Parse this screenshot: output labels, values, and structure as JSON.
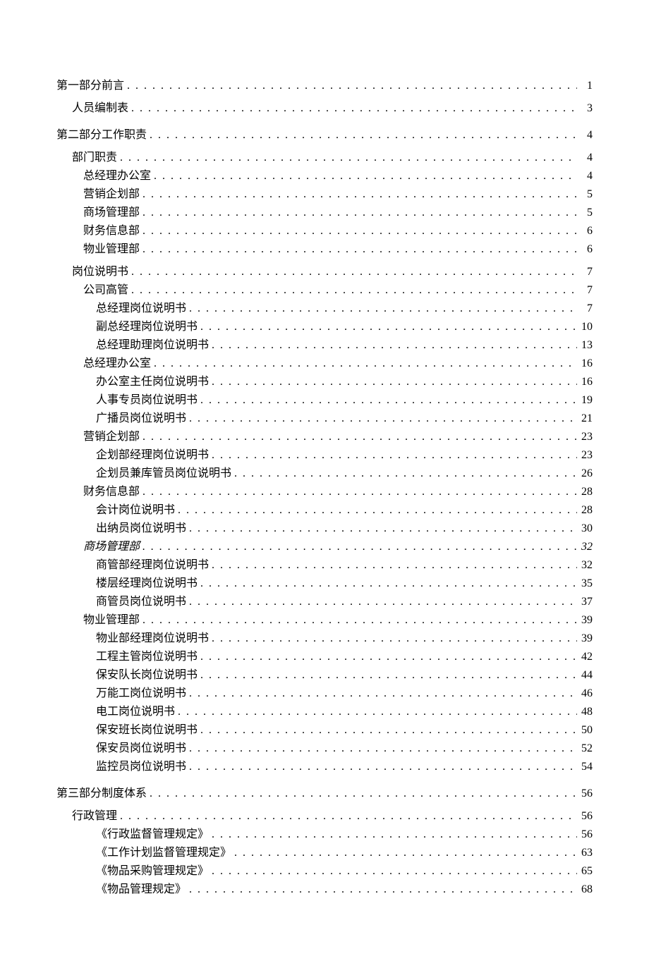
{
  "toc": [
    {
      "level": 0,
      "title": "第一部分前言",
      "page": "1",
      "first": true
    },
    {
      "level": 1,
      "title": "人员编制表",
      "page": "3"
    },
    {
      "level": 0,
      "title": "第二部分工作职责",
      "page": "4"
    },
    {
      "level": 1,
      "title": "部门职责",
      "page": "4"
    },
    {
      "level": 2,
      "title": "总经理办公室",
      "page": "4"
    },
    {
      "level": 2,
      "title": "营销企划部",
      "page": "5"
    },
    {
      "level": 2,
      "title": "商场管理部",
      "page": "5"
    },
    {
      "level": 2,
      "title": "财务信息部",
      "page": "6"
    },
    {
      "level": 2,
      "title": "物业管理部",
      "page": "6"
    },
    {
      "level": 1,
      "title": "岗位说明书",
      "page": "7"
    },
    {
      "level": 2,
      "title": "公司高管",
      "page": "7"
    },
    {
      "level": 3,
      "title": "总经理岗位说明书",
      "page": "7"
    },
    {
      "level": 3,
      "title": "副总经理岗位说明书",
      "page": "10"
    },
    {
      "level": 3,
      "title": "总经理助理岗位说明书",
      "page": "13"
    },
    {
      "level": 2,
      "title": "总经理办公室",
      "page": "16"
    },
    {
      "level": 3,
      "title": "办公室主任岗位说明书",
      "page": "16"
    },
    {
      "level": 3,
      "title": "人事专员岗位说明书",
      "page": "19"
    },
    {
      "level": 3,
      "title": "广播员岗位说明书",
      "page": "21"
    },
    {
      "level": 2,
      "title": "营销企划部",
      "page": "23"
    },
    {
      "level": 3,
      "title": "企划部经理岗位说明书",
      "page": "23"
    },
    {
      "level": 3,
      "title": "企划员兼库管员岗位说明书",
      "page": "26"
    },
    {
      "level": 2,
      "title": "财务信息部",
      "page": "28"
    },
    {
      "level": 3,
      "title": "会计岗位说明书",
      "page": "28"
    },
    {
      "level": 3,
      "title": "出纳员岗位说明书",
      "page": "30"
    },
    {
      "level": 2,
      "title": "商场管理部",
      "page": "32",
      "italic": true
    },
    {
      "level": 3,
      "title": "商管部经理岗位说明书",
      "page": "32"
    },
    {
      "level": 3,
      "title": "楼层经理岗位说明书",
      "page": "35"
    },
    {
      "level": 3,
      "title": "商管员岗位说明书",
      "page": "37"
    },
    {
      "level": 2,
      "title": "物业管理部",
      "page": "39"
    },
    {
      "level": 3,
      "title": "物业部经理岗位说明书",
      "page": "39"
    },
    {
      "level": 3,
      "title": "工程主管岗位说明书",
      "page": "42"
    },
    {
      "level": 3,
      "title": "保安队长岗位说明书",
      "page": "44"
    },
    {
      "level": 3,
      "title": "万能工岗位说明书",
      "page": "46"
    },
    {
      "level": 3,
      "title": "电工岗位说明书",
      "page": "48"
    },
    {
      "level": 3,
      "title": "保安班长岗位说明书",
      "page": "50"
    },
    {
      "level": 3,
      "title": "保安员岗位说明书",
      "page": "52"
    },
    {
      "level": 3,
      "title": "监控员岗位说明书",
      "page": "54"
    },
    {
      "level": 0,
      "title": "第三部分制度体系",
      "page": "56"
    },
    {
      "level": 1,
      "title": "行政管理",
      "page": "56"
    },
    {
      "level": 3,
      "title": "《行政监督管理规定》",
      "page": "56"
    },
    {
      "level": 3,
      "title": "《工作计划监督管理规定》",
      "page": "63"
    },
    {
      "level": 3,
      "title": "《物品采购管理规定》",
      "page": "65"
    },
    {
      "level": 3,
      "title": "《物品管理规定》",
      "page": "68"
    }
  ]
}
